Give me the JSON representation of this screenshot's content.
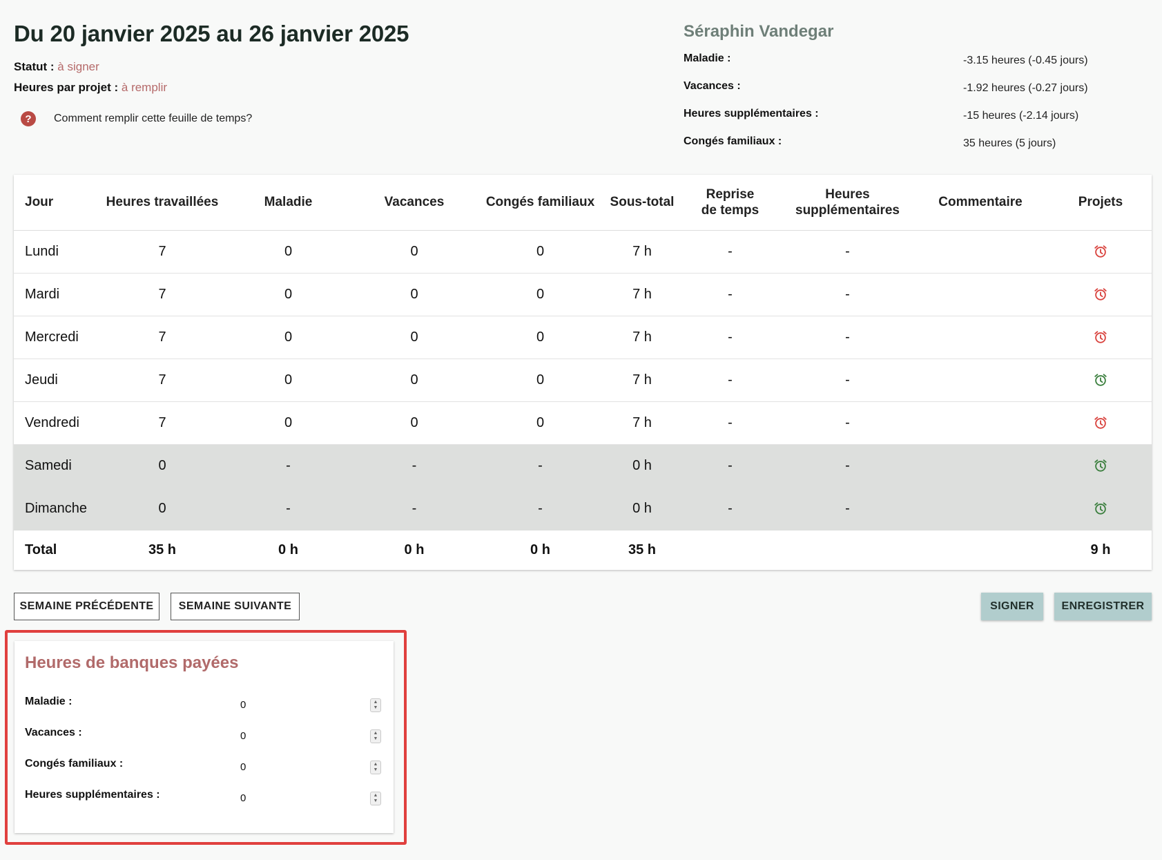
{
  "header": {
    "title": "Du 20 janvier 2025 au 26 janvier 2025",
    "status_label": "Statut :",
    "status_value": "à signer",
    "project_hours_label": "Heures par projet :",
    "project_hours_value": "à remplir",
    "help_text": "Comment remplir cette feuille de temps?"
  },
  "bank": {
    "employee_name": "Séraphin Vandegar",
    "rows": [
      {
        "label": "Maladie :",
        "value": "-3.15 heures (-0.45 jours)"
      },
      {
        "label": "Vacances :",
        "value": "-1.92 heures (-0.27 jours)"
      },
      {
        "label": "Heures supplémentaires :",
        "value": "-15 heures (-2.14 jours)"
      },
      {
        "label": "Congés familiaux :",
        "value": "35 heures (5 jours)"
      }
    ]
  },
  "table": {
    "headers": [
      "Jour",
      "Heures travaillées",
      "Maladie",
      "Vacances",
      "Congés familiaux",
      "Sous-total",
      "Reprise\nde temps",
      "Heures\nsupplémentaires",
      "Commentaire",
      "Projets"
    ],
    "rows": [
      {
        "day": "Lundi",
        "worked": "7",
        "sick": "0",
        "vacation": "0",
        "family": "0",
        "subtotal": "7 h",
        "reprise": "-",
        "overtime": "-",
        "comment": "",
        "project_status": "alarm-red"
      },
      {
        "day": "Mardi",
        "worked": "7",
        "sick": "0",
        "vacation": "0",
        "family": "0",
        "subtotal": "7 h",
        "reprise": "-",
        "overtime": "-",
        "comment": "",
        "project_status": "alarm-red"
      },
      {
        "day": "Mercredi",
        "worked": "7",
        "sick": "0",
        "vacation": "0",
        "family": "0",
        "subtotal": "7 h",
        "reprise": "-",
        "overtime": "-",
        "comment": "",
        "project_status": "alarm-red"
      },
      {
        "day": "Jeudi",
        "worked": "7",
        "sick": "0",
        "vacation": "0",
        "family": "0",
        "subtotal": "7 h",
        "reprise": "-",
        "overtime": "-",
        "comment": "",
        "project_status": "alarm-green"
      },
      {
        "day": "Vendredi",
        "worked": "7",
        "sick": "0",
        "vacation": "0",
        "family": "0",
        "subtotal": "7 h",
        "reprise": "-",
        "overtime": "-",
        "comment": "",
        "project_status": "alarm-red"
      },
      {
        "day": "Samedi",
        "worked": "0",
        "sick": "-",
        "vacation": "-",
        "family": "-",
        "subtotal": "0 h",
        "reprise": "-",
        "overtime": "-",
        "comment": "",
        "project_status": "alarm-green"
      },
      {
        "day": "Dimanche",
        "worked": "0",
        "sick": "-",
        "vacation": "-",
        "family": "-",
        "subtotal": "0 h",
        "reprise": "-",
        "overtime": "-",
        "comment": "",
        "project_status": "alarm-green"
      }
    ],
    "total": {
      "label": "Total",
      "worked": "35 h",
      "sick": "0 h",
      "vacation": "0 h",
      "family": "0 h",
      "subtotal": "35 h",
      "projects": "9 h"
    }
  },
  "buttons": {
    "prev_week": "SEMAINE PRÉCÉDENTE",
    "next_week": "SEMAINE SUIVANTE",
    "sign": "SIGNER",
    "save": "ENREGISTRER"
  },
  "paid_bank": {
    "title": "Heures de banques payées",
    "fields": [
      {
        "label": "Maladie :",
        "value": "0"
      },
      {
        "label": "Vacances :",
        "value": "0"
      },
      {
        "label": "Congés familiaux :",
        "value": "0"
      },
      {
        "label": "Heures supplémentaires :",
        "value": "0"
      }
    ]
  },
  "colors": {
    "alarm_red": "#d9433e",
    "alarm_green": "#3b7f3e",
    "accent_red_text": "#b56a6a",
    "button_fill": "#b1cdcd",
    "highlight_border": "#e0403e"
  }
}
